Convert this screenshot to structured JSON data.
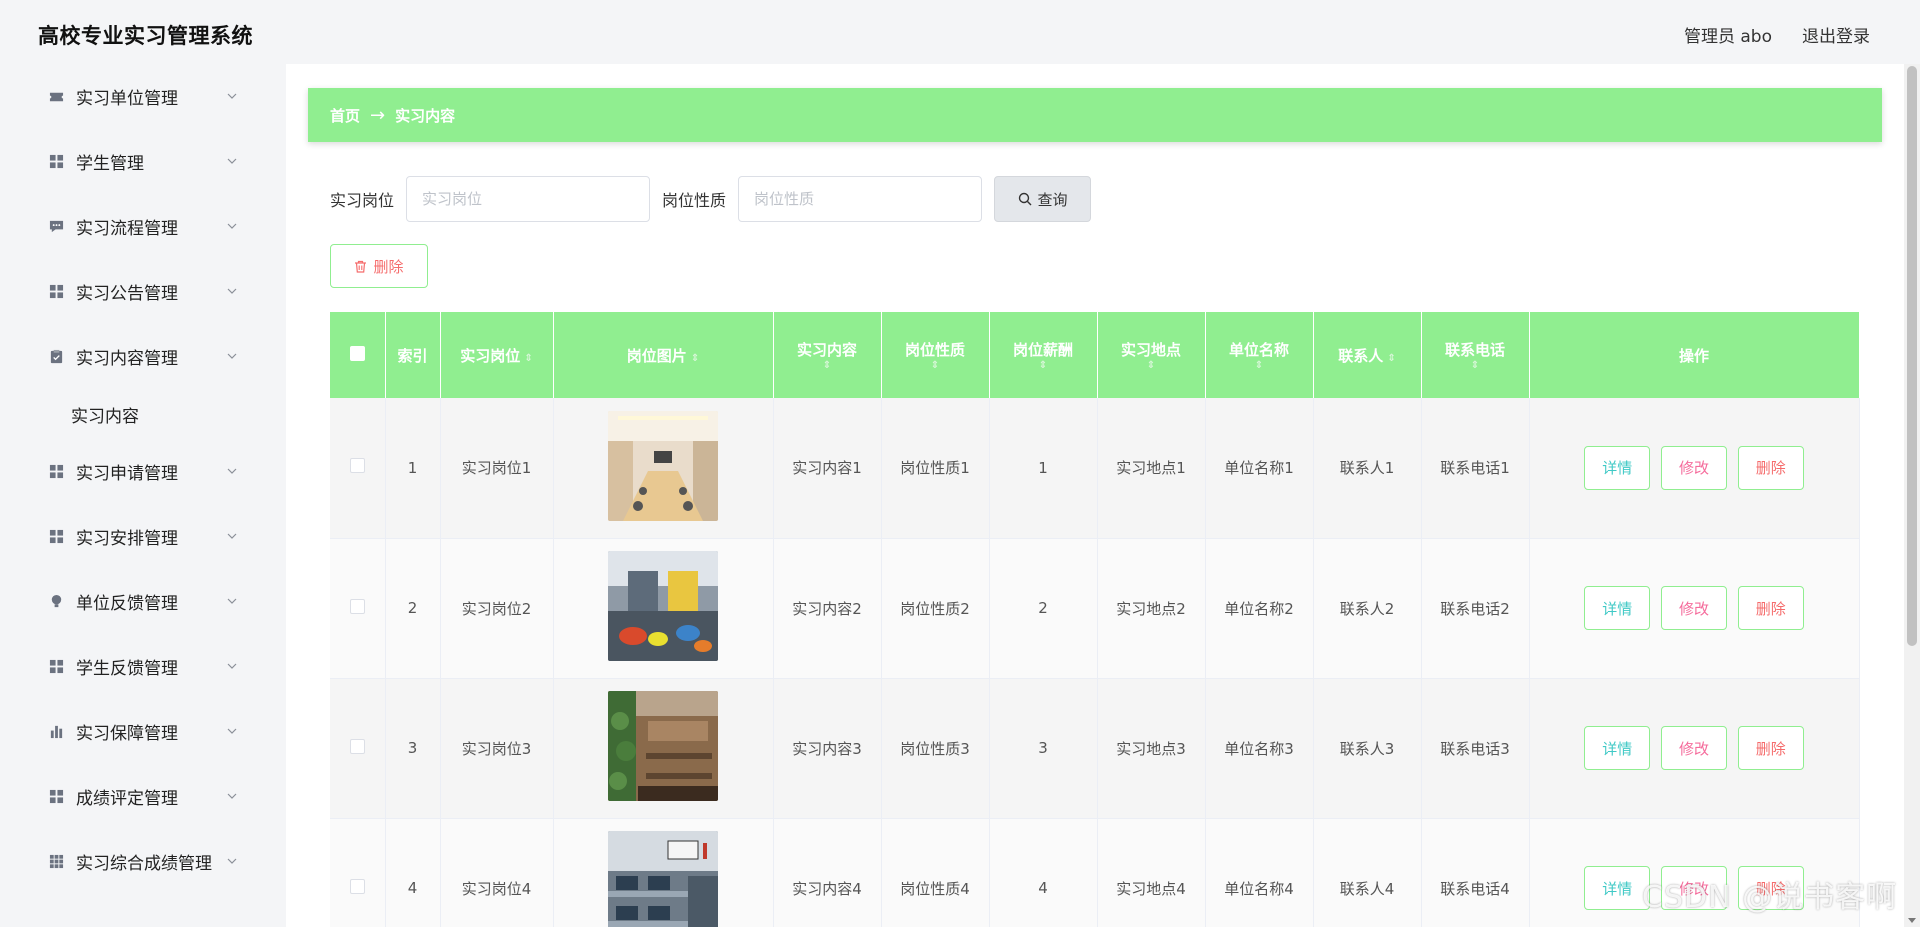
{
  "app": {
    "title": "高校专业实习管理系统"
  },
  "topbar": {
    "user_label": "管理员 abo",
    "logout_label": "退出登录"
  },
  "sidebar": {
    "items": [
      {
        "label": "实习单位管理",
        "icon": "ticket-icon"
      },
      {
        "label": "学生管理",
        "icon": "grid-icon"
      },
      {
        "label": "实习流程管理",
        "icon": "comment-icon"
      },
      {
        "label": "实习公告管理",
        "icon": "grid-icon"
      },
      {
        "label": "实习内容管理",
        "icon": "clipboard-icon",
        "expanded": true,
        "children": [
          "实习内容"
        ]
      },
      {
        "label": "实习申请管理",
        "icon": "grid-icon"
      },
      {
        "label": "实习安排管理",
        "icon": "grid-icon"
      },
      {
        "label": "单位反馈管理",
        "icon": "bulb-icon"
      },
      {
        "label": "学生反馈管理",
        "icon": "grid-icon"
      },
      {
        "label": "实习保障管理",
        "icon": "bar-chart-icon"
      },
      {
        "label": "成绩评定管理",
        "icon": "grid-icon"
      },
      {
        "label": "实习综合成绩管理",
        "icon": "grid-9-icon"
      }
    ]
  },
  "breadcrumb": {
    "home": "首页",
    "separator": "→",
    "current": "实习内容"
  },
  "search": {
    "field1_label": "实习岗位",
    "field1_placeholder": "实习岗位",
    "field2_label": "岗位性质",
    "field2_placeholder": "岗位性质",
    "query_label": "查询"
  },
  "toolbar": {
    "delete_label": "删除"
  },
  "table": {
    "headers": [
      "索引",
      "实习岗位",
      "岗位图片",
      "实习内容",
      "岗位性质",
      "岗位薪酬",
      "实习地点",
      "单位名称",
      "联系人",
      "联系电话",
      "操作"
    ],
    "rows": [
      {
        "index": "1",
        "post": "实习岗位1",
        "image": "meeting-room-photo",
        "content": "实习内容1",
        "nature": "岗位性质1",
        "salary": "1",
        "location": "实习地点1",
        "unit": "单位名称1",
        "contact": "联系人1",
        "phone": "联系电话1"
      },
      {
        "index": "2",
        "post": "实习岗位2",
        "image": "lounge-photo",
        "content": "实习内容2",
        "nature": "岗位性质2",
        "salary": "2",
        "location": "实习地点2",
        "unit": "单位名称2",
        "contact": "联系人2",
        "phone": "联系电话2"
      },
      {
        "index": "3",
        "post": "实习岗位3",
        "image": "cafe-office-photo",
        "content": "实习内容3",
        "nature": "岗位性质3",
        "salary": "3",
        "location": "实习地点3",
        "unit": "单位名称3",
        "contact": "联系人3",
        "phone": "联系电话3"
      },
      {
        "index": "4",
        "post": "实习岗位4",
        "image": "open-office-photo",
        "content": "实习内容4",
        "nature": "岗位性质4",
        "salary": "4",
        "location": "实习地点4",
        "unit": "单位名称4",
        "contact": "联系人4",
        "phone": "联系电话4"
      }
    ],
    "actions": {
      "detail": "详情",
      "edit": "修改",
      "delete": "删除"
    }
  },
  "watermark": "CSDN @说书客啊",
  "colors": {
    "accent": "#90ee90",
    "danger": "#f56c6c",
    "info": "#40c9c6",
    "edit": "#f56c9c"
  }
}
